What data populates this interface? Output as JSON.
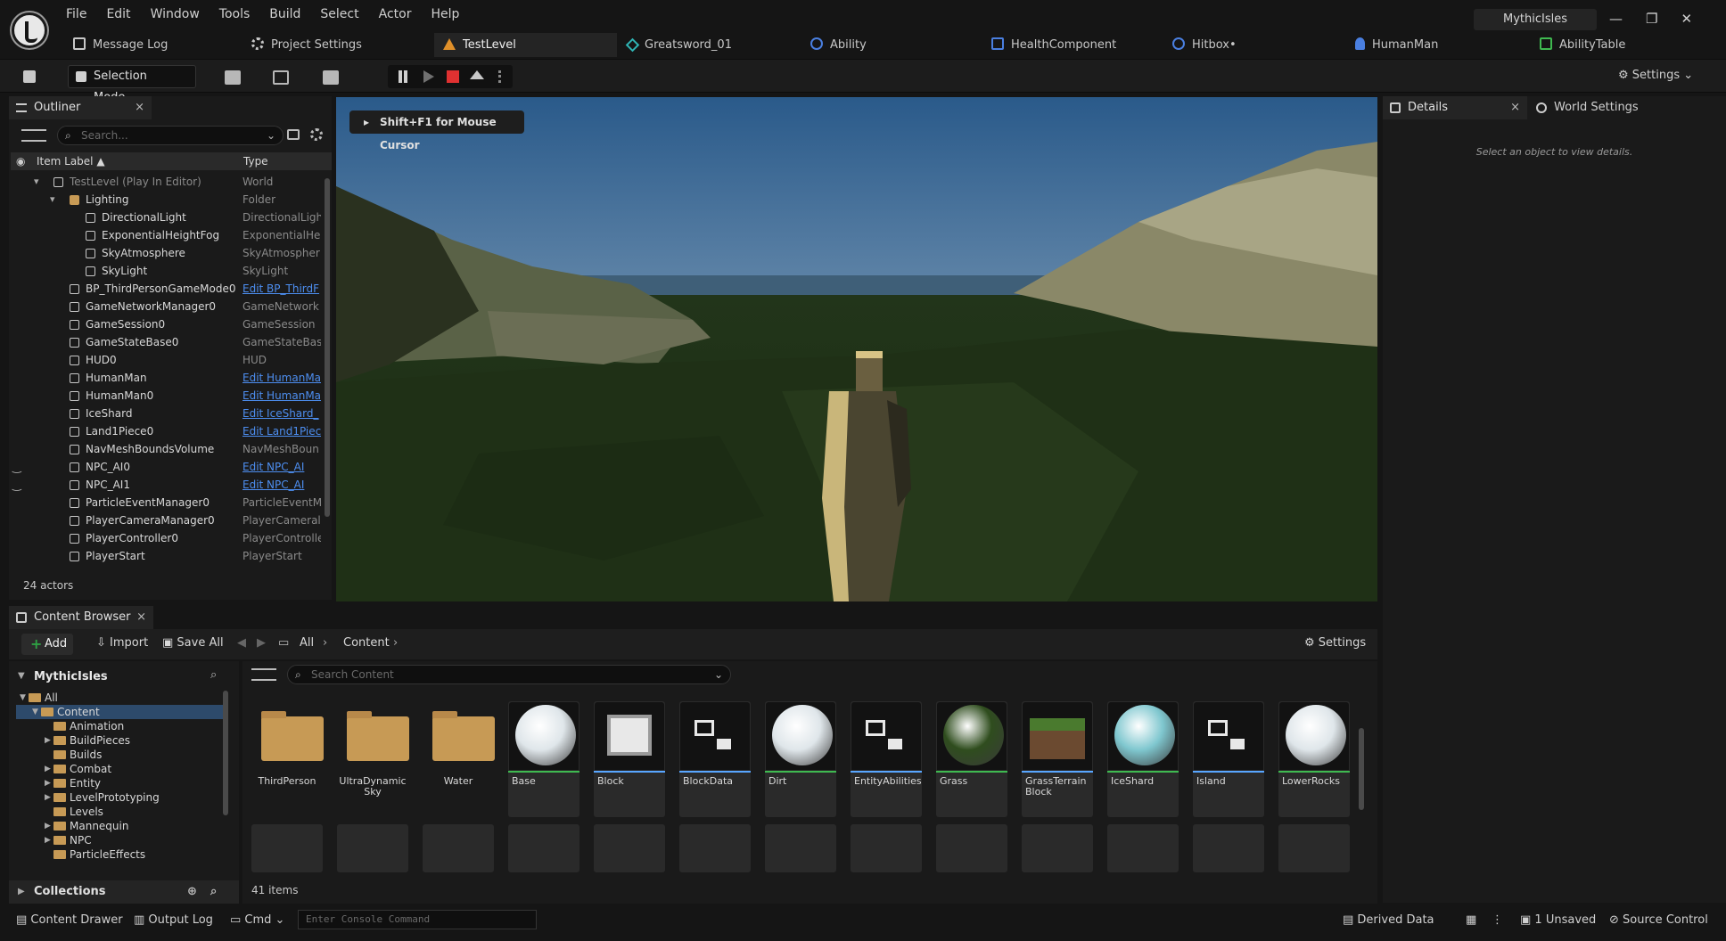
{
  "menu": {
    "items": [
      "File",
      "Edit",
      "Window",
      "Tools",
      "Build",
      "Select",
      "Actor",
      "Help"
    ],
    "project": "MythicIsles"
  },
  "tabs": [
    {
      "label": "Message Log",
      "icon": "log-icon"
    },
    {
      "label": "Project Settings",
      "icon": "gear-icon"
    },
    {
      "label": "TestLevel",
      "icon": "level-icon"
    },
    {
      "label": "Greatsword_01",
      "icon": "mesh-icon"
    },
    {
      "label": "Ability",
      "icon": "blueprint-icon"
    },
    {
      "label": "HealthComponent",
      "icon": "component-icon"
    },
    {
      "label": "Hitbox•",
      "icon": "blueprint-icon"
    },
    {
      "label": "HumanMan",
      "icon": "character-icon"
    },
    {
      "label": "AbilityTable",
      "icon": "table-icon"
    }
  ],
  "toolbar": {
    "selection_mode": "Selection Mode",
    "settings": "Settings"
  },
  "outliner": {
    "title": "Outliner",
    "search_placeholder": "Search...",
    "col_label": "Item Label ▲",
    "col_type": "Type",
    "rows": [
      {
        "label": "TestLevel (Play In Editor)",
        "type": "World",
        "indent": 0,
        "dim": true
      },
      {
        "label": "Lighting",
        "type": "Folder",
        "indent": 1
      },
      {
        "label": "DirectionalLight",
        "type": "DirectionalLigh",
        "indent": 2
      },
      {
        "label": "ExponentialHeightFog",
        "type": "ExponentialHei",
        "indent": 2
      },
      {
        "label": "SkyAtmosphere",
        "type": "SkyAtmospher",
        "indent": 2
      },
      {
        "label": "SkyLight",
        "type": "SkyLight",
        "indent": 2
      },
      {
        "label": "BP_ThirdPersonGameMode0",
        "type": "Edit BP_ThirdF",
        "indent": 1,
        "link": true
      },
      {
        "label": "GameNetworkManager0",
        "type": "GameNetwork",
        "indent": 1
      },
      {
        "label": "GameSession0",
        "type": "GameSession",
        "indent": 1
      },
      {
        "label": "GameStateBase0",
        "type": "GameStateBas",
        "indent": 1
      },
      {
        "label": "HUD0",
        "type": "HUD",
        "indent": 1
      },
      {
        "label": "HumanMan",
        "type": "Edit HumanMa",
        "indent": 1,
        "link": true
      },
      {
        "label": "HumanMan0",
        "type": "Edit HumanMa",
        "indent": 1,
        "link": true
      },
      {
        "label": "IceShard",
        "type": "Edit IceShard_",
        "indent": 1,
        "link": true
      },
      {
        "label": "Land1Piece0",
        "type": "Edit Land1Piec",
        "indent": 1,
        "link": true
      },
      {
        "label": "NavMeshBoundsVolume",
        "type": "NavMeshBoun",
        "indent": 1
      },
      {
        "label": "NPC_AI0",
        "type": "Edit NPC_AI",
        "indent": 1,
        "link": true
      },
      {
        "label": "NPC_AI1",
        "type": "Edit NPC_AI",
        "indent": 1,
        "link": true
      },
      {
        "label": "ParticleEventManager0",
        "type": "ParticleEventM",
        "indent": 1
      },
      {
        "label": "PlayerCameraManager0",
        "type": "PlayerCameral",
        "indent": 1
      },
      {
        "label": "PlayerController0",
        "type": "PlayerControlle",
        "indent": 1
      },
      {
        "label": "PlayerStart",
        "type": "PlayerStart",
        "indent": 1
      }
    ],
    "actor_count": "24 actors"
  },
  "viewport": {
    "hint": "Shift+F1 for Mouse Cursor"
  },
  "details": {
    "title": "Details",
    "world_settings": "World Settings",
    "empty_text": "Select an object to view details."
  },
  "content_browser": {
    "title": "Content Browser",
    "add": "Add",
    "import": "Import",
    "save_all": "Save All",
    "breadcrumb_all": "All",
    "breadcrumb_content": "Content",
    "settings": "Settings",
    "root": "MythicIsles",
    "search_placeholder": "Search Content",
    "tree": [
      {
        "label": "All",
        "indent": 0,
        "open": true
      },
      {
        "label": "Content",
        "indent": 1,
        "open": true,
        "selected": true
      },
      {
        "label": "Animation",
        "indent": 2
      },
      {
        "label": "BuildPieces",
        "indent": 2,
        "children": true
      },
      {
        "label": "Builds",
        "indent": 2
      },
      {
        "label": "Combat",
        "indent": 2,
        "children": true
      },
      {
        "label": "Entity",
        "indent": 2,
        "children": true
      },
      {
        "label": "LevelPrototyping",
        "indent": 2,
        "children": true
      },
      {
        "label": "Levels",
        "indent": 2
      },
      {
        "label": "Mannequin",
        "indent": 2,
        "children": true
      },
      {
        "label": "NPC",
        "indent": 2,
        "children": true
      },
      {
        "label": "ParticleEffects",
        "indent": 2
      }
    ],
    "collections": "Collections",
    "assets": [
      {
        "name": "ThirdPerson",
        "kind": "folder"
      },
      {
        "name": "UltraDynamic Sky",
        "kind": "folder"
      },
      {
        "name": "Water",
        "kind": "folder"
      },
      {
        "name": "Base",
        "kind": "sphere",
        "color": "#dfe6ea",
        "bar": "#3fb950"
      },
      {
        "name": "Block",
        "kind": "block",
        "bar": "#58a6ff"
      },
      {
        "name": "BlockData",
        "kind": "data",
        "bar": "#58a6ff"
      },
      {
        "name": "Dirt",
        "kind": "sphere",
        "color": "#dfe6ea",
        "bar": "#3fb950"
      },
      {
        "name": "EntityAbilities",
        "kind": "data",
        "bar": "#58a6ff"
      },
      {
        "name": "Grass",
        "kind": "sphere",
        "color": "#2f4d1e",
        "bar": "#3fb950"
      },
      {
        "name": "GrassTerrain Block",
        "kind": "cube",
        "bar": "#58a6ff"
      },
      {
        "name": "IceShard",
        "kind": "sphere",
        "color": "#7fc7cf",
        "bar": "#3fb950"
      },
      {
        "name": "Island",
        "kind": "data",
        "bar": "#58a6ff"
      },
      {
        "name": "LowerRocks",
        "kind": "sphere",
        "color": "#dfe6ea",
        "bar": "#3fb950"
      }
    ],
    "items_count": "41 items"
  },
  "status": {
    "content_drawer": "Content Drawer",
    "output_log": "Output Log",
    "cmd": "Cmd",
    "console_placeholder": "Enter Console Command",
    "derived_data": "Derived Data",
    "unsaved": "1 Unsaved",
    "source_control": "Source Control"
  }
}
